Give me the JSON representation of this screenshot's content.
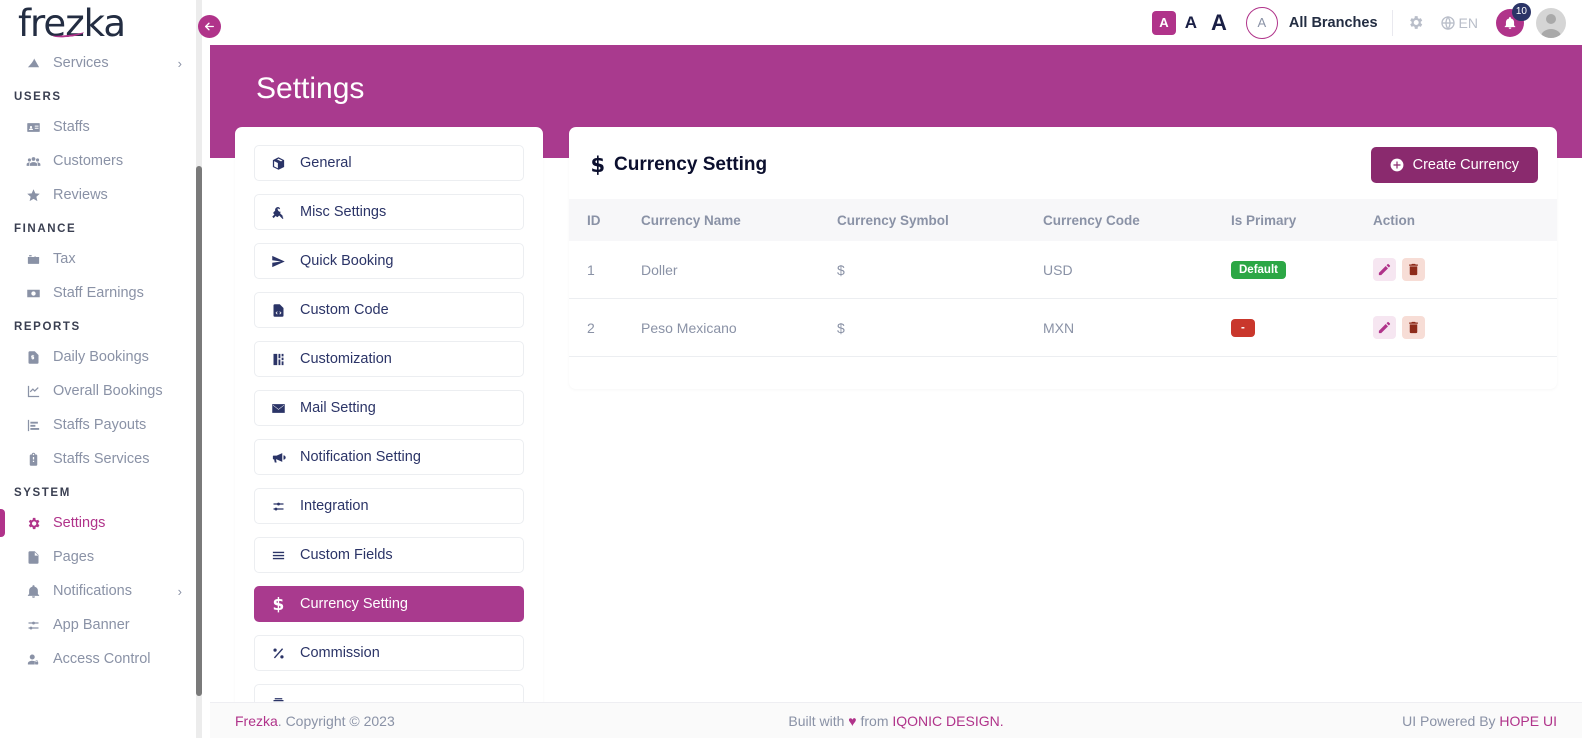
{
  "app": {
    "logo": "frezka"
  },
  "sidebar": {
    "sections": [
      {
        "label": "",
        "items": [
          {
            "label": "Services",
            "icon": "services-icon",
            "caret": "›",
            "active": false
          }
        ]
      },
      {
        "label": "USERS",
        "items": [
          {
            "label": "Staffs",
            "icon": "id-card-icon",
            "caret": "",
            "active": false
          },
          {
            "label": "Customers",
            "icon": "users-icon",
            "caret": "",
            "active": false
          },
          {
            "label": "Reviews",
            "icon": "star-icon",
            "caret": "",
            "active": false
          }
        ]
      },
      {
        "label": "FINANCE",
        "items": [
          {
            "label": "Tax",
            "icon": "tax-icon",
            "caret": "",
            "active": false
          },
          {
            "label": "Staff Earnings",
            "icon": "money-icon",
            "caret": "",
            "active": false
          }
        ]
      },
      {
        "label": "REPORTS",
        "items": [
          {
            "label": "Daily Bookings",
            "icon": "report-doc-icon",
            "caret": "",
            "active": false
          },
          {
            "label": "Overall Bookings",
            "icon": "line-chart-icon",
            "caret": "",
            "active": false
          },
          {
            "label": "Staffs Payouts",
            "icon": "bar-chart-icon",
            "caret": "",
            "active": false
          },
          {
            "label": "Staffs Services",
            "icon": "clipboard-icon",
            "caret": "",
            "active": false
          }
        ]
      },
      {
        "label": "SYSTEM",
        "items": [
          {
            "label": "Settings",
            "icon": "gear-icon",
            "caret": "",
            "active": true
          },
          {
            "label": "Pages",
            "icon": "page-icon",
            "caret": "",
            "active": false
          },
          {
            "label": "Notifications",
            "icon": "bell-icon",
            "caret": "›",
            "active": false
          },
          {
            "label": "App Banner",
            "icon": "sliders-icon",
            "caret": "",
            "active": false
          },
          {
            "label": "Access Control",
            "icon": "user-lock-icon",
            "caret": "",
            "active": false
          }
        ]
      }
    ]
  },
  "topbar": {
    "collapse_icon": "arrow-left-icon",
    "font_sizes": [
      {
        "label": "A",
        "size": "sm",
        "active": true
      },
      {
        "label": "A",
        "size": "md",
        "active": false
      },
      {
        "label": "A",
        "size": "lg",
        "active": false
      }
    ],
    "branch_initial": "A",
    "branch_label": "All Branches",
    "gear_icon": "gear-icon",
    "language": "EN",
    "globe_icon": "globe-icon",
    "bell_icon": "bell-icon",
    "notification_count": "10",
    "avatar_icon": "avatar-icon"
  },
  "banner": {
    "title": "Settings"
  },
  "settings_menu": {
    "items": [
      {
        "label": "General",
        "icon": "box-icon",
        "active": false
      },
      {
        "label": "Misc Settings",
        "icon": "tools-icon",
        "active": false
      },
      {
        "label": "Quick Booking",
        "icon": "paper-plane-icon",
        "active": false
      },
      {
        "label": "Custom Code",
        "icon": "code-file-icon",
        "active": false
      },
      {
        "label": "Customization",
        "icon": "palette-icon",
        "active": false
      },
      {
        "label": "Mail Setting",
        "icon": "envelope-icon",
        "active": false
      },
      {
        "label": "Notification Setting",
        "icon": "megaphone-icon",
        "active": false
      },
      {
        "label": "Integration",
        "icon": "sliders-icon",
        "active": false
      },
      {
        "label": "Custom Fields",
        "icon": "list-icon",
        "active": false
      },
      {
        "label": "Currency Setting",
        "icon": "dollar-icon",
        "active": true
      },
      {
        "label": "Commission",
        "icon": "percent-icon",
        "active": false
      },
      {
        "label": "",
        "icon": "partial-icon",
        "active": false
      }
    ]
  },
  "currency_card": {
    "title": "Currency Setting",
    "title_icon": "dollar-icon",
    "create_label": "Create Currency",
    "create_icon": "plus-circle-icon",
    "columns": [
      "ID",
      "Currency Name",
      "Currency Symbol",
      "Currency Code",
      "Is Primary",
      "Action"
    ],
    "rows": [
      {
        "id": "1",
        "name": "Doller",
        "symbol": "$",
        "code": "USD",
        "is_primary": "Default",
        "is_primary_state": "default",
        "edit_icon": "pencil-icon",
        "delete_icon": "trash-icon"
      },
      {
        "id": "2",
        "name": "Peso Mexicano",
        "symbol": "$",
        "code": "MXN",
        "is_primary": "-",
        "is_primary_state": "none",
        "edit_icon": "pencil-icon",
        "delete_icon": "trash-icon"
      }
    ]
  },
  "footer": {
    "brand": "Frezka",
    "copyright": ". Copyright © 2023",
    "center_prefix": "Built with ",
    "center_heart": "♥",
    "center_mid": " from ",
    "center_brand": "IQONIC DESIGN.",
    "right_prefix": "UI Powered By ",
    "right_brand": "HOPE UI"
  },
  "colors": {
    "accent": "#b0338a",
    "banner": "#a93a8e",
    "button": "#8a2a6e",
    "success": "#2ca745",
    "danger": "#c9372c",
    "navy": "#2b3467"
  }
}
